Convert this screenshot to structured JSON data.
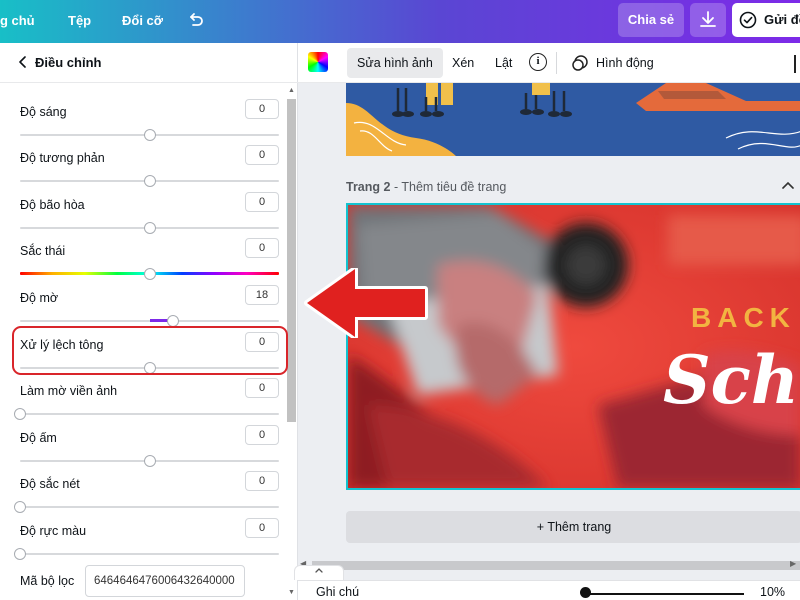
{
  "topbar": {
    "home": "ng chủ",
    "file": "Tệp",
    "resize": "Đổi cỡ",
    "share": "Chia sẻ",
    "send": "Gửi đề"
  },
  "panel": {
    "back": "Điều chỉnh",
    "adjustments": [
      {
        "label": "Độ sáng",
        "value": "0",
        "level": 0.5
      },
      {
        "label": "Độ tương phản",
        "value": "0",
        "level": 0.5
      },
      {
        "label": "Độ bão hòa",
        "value": "0",
        "level": 0.5
      },
      {
        "label": "Sắc thái",
        "value": "0",
        "level": 0.5
      },
      {
        "label": "Độ mờ",
        "value": "18",
        "level": 0.59
      },
      {
        "label": "Xử lý lệch tông",
        "value": "0",
        "level": 0.5
      },
      {
        "label": "Làm mờ viền ảnh",
        "value": "0",
        "level": 0
      },
      {
        "label": "Độ ấm",
        "value": "0",
        "level": 0.5
      },
      {
        "label": "Độ sắc nét",
        "value": "0",
        "level": 0
      },
      {
        "label": "Độ rực màu",
        "value": "0",
        "level": 0
      }
    ],
    "filter_label": "Mã bộ lọc",
    "filter_code": "6464646476006432640000"
  },
  "toolbar": {
    "edit_image": "Sửa hình ảnh",
    "crop": "Xén",
    "flip": "Lật",
    "info": "i",
    "animate": "Hình động"
  },
  "canvas": {
    "page_number": "Trang 2",
    "page_title": "Thêm tiêu đề trang",
    "back_text": "BACK",
    "school_text": "Scho",
    "add_page": "+ Thêm trang"
  },
  "bottom": {
    "notes": "Ghi chú",
    "zoom": "10%"
  },
  "colors": {
    "accent": "#7d2ae8",
    "selection": "#13c3d0",
    "highlight": "#d9252a"
  }
}
